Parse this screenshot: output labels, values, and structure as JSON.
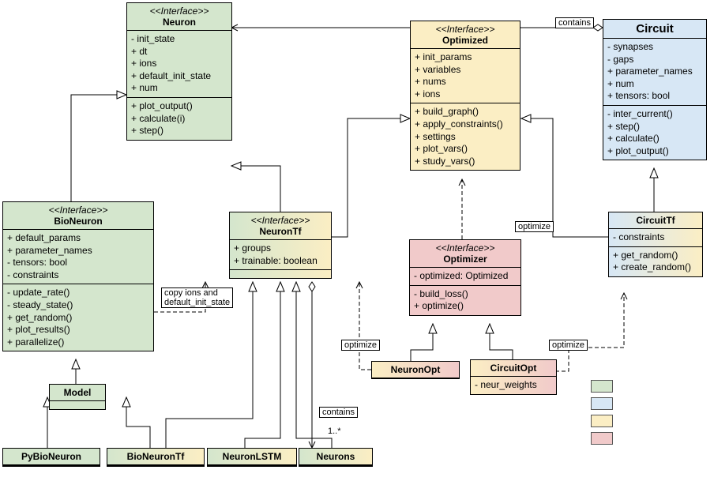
{
  "neuron": {
    "stereo": "<<Interface>>",
    "name": "Neuron",
    "attrs": "- init_state\n+ dt\n+ ions\n+ default_init_state\n+ num",
    "ops": "+ plot_output()\n+ calculate(i)\n+ step()"
  },
  "optimized": {
    "stereo": "<<Interface>>",
    "name": "Optimized",
    "attrs": "+ init_params\n+ variables\n+ nums\n+ ions",
    "ops": "+ build_graph()\n+ apply_constraints()\n+ settings\n+ plot_vars()\n+ study_vars()"
  },
  "circuit": {
    "name": "Circuit",
    "attrs": "- synapses\n- gaps\n+ parameter_names\n+ num\n+ tensors: bool",
    "ops": "- inter_current()\n+ step()\n+ calculate()\n+ plot_output()"
  },
  "bioneuron": {
    "stereo": "<<Interface>>",
    "name": "BioNeuron",
    "attrs": "+ default_params\n+ parameter_names\n- tensors: bool\n- constraints",
    "ops": "- update_rate()\n- steady_state()\n+ get_random()\n+ plot_results()\n+ parallelize()"
  },
  "neurontf": {
    "stereo": "<<Interface>>",
    "name": "NeuronTf",
    "attrs": "+ groups\n+ trainable: boolean"
  },
  "optimizer": {
    "stereo": "<<Interface>>",
    "name": "Optimizer",
    "attrs": "- optimized: Optimized",
    "ops": "- build_loss()\n+ optimize()"
  },
  "circuittf": {
    "name": "CircuitTf",
    "attrs": "- constraints",
    "ops": "+ get_random()\n+ create_random()"
  },
  "model": {
    "name": "Model"
  },
  "neuronopt": {
    "name": "NeuronOpt"
  },
  "circuitopt": {
    "name": "CircuitOpt",
    "attrs": "- neur_weights"
  },
  "pybioneuron": {
    "name": "PyBioNeuron"
  },
  "bioneurontf": {
    "name": "BioNeuronTf"
  },
  "neuronlstm": {
    "name": "NeuronLSTM"
  },
  "neurons": {
    "name": "Neurons"
  },
  "labels": {
    "contains1": "contains",
    "optimize1": "optimize",
    "optimize2": "optimize",
    "optimize3": "optimize",
    "copyions": "copy ions and\ndefault_init_state",
    "contains2": "contains",
    "mult": "1..*"
  },
  "colors": {
    "green": "#d4e6cd",
    "blue": "#d7e7f5",
    "cream": "#fbeec4",
    "pink": "#f1caca"
  }
}
